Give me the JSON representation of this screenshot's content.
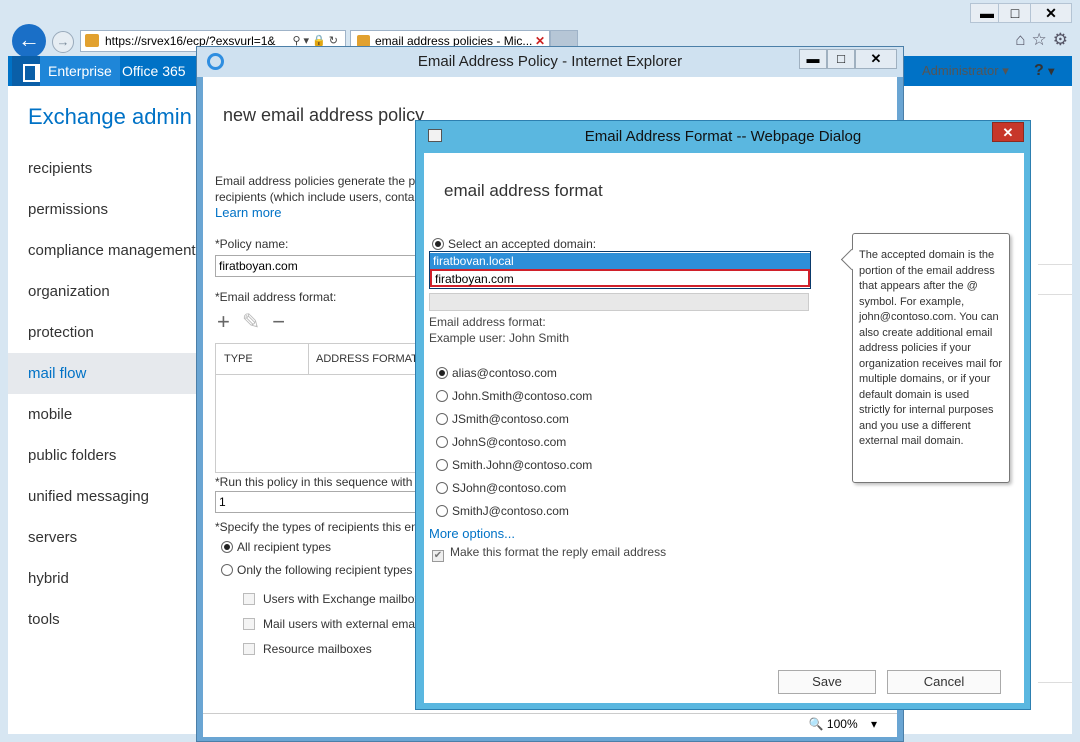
{
  "browser": {
    "url": "https://srvex16/ecp/?exsvurl=1&",
    "tab_title": "email address policies - Mic...",
    "window_controls": {
      "minimize": "▬",
      "maximize": "□",
      "close": "✕"
    }
  },
  "eac": {
    "header_links": [
      "Enterprise",
      "Office 365"
    ],
    "title": "Exchange admin c",
    "user": "Administrator",
    "help": "?",
    "nav": [
      {
        "label": "recipients",
        "active": false
      },
      {
        "label": "permissions",
        "active": false
      },
      {
        "label": "compliance management",
        "active": false
      },
      {
        "label": "organization",
        "active": false
      },
      {
        "label": "protection",
        "active": false
      },
      {
        "label": "mail flow",
        "active": true
      },
      {
        "label": "mobile",
        "active": false
      },
      {
        "label": "public folders",
        "active": false
      },
      {
        "label": "unified messaging",
        "active": false
      },
      {
        "label": "servers",
        "active": false
      },
      {
        "label": "hybrid",
        "active": false
      },
      {
        "label": "tools",
        "active": false
      }
    ]
  },
  "policy_window": {
    "title": "Email Address Policy - Internet Explorer",
    "heading": "new email address policy",
    "description_line1": "Email address policies generate the pr",
    "description_line2": "recipients (which include users, conta",
    "learn_more": "Learn more",
    "policy_name_label": "*Policy name:",
    "policy_name_value": "firatboyan.com",
    "email_format_label": "*Email address format:",
    "table_headers": [
      "TYPE",
      "ADDRESS FORMAT"
    ],
    "sequence_label": "*Run this policy in this sequence with",
    "sequence_value": "1",
    "recipient_types_label": "*Specify the types of recipients this en",
    "recipient_options": [
      "All recipient types",
      "Only the following recipient types"
    ],
    "recipient_checkboxes": [
      "Users with Exchange mailbox",
      "Mail users with external emai",
      "Resource mailboxes"
    ],
    "zoom": "100%"
  },
  "dialog": {
    "title": "Email Address Format -- Webpage Dialog",
    "close": "✕",
    "heading": "email address format",
    "select_domain_label": "Select an accepted domain:",
    "domains": [
      "firatbovan.local",
      "firatboyan.com"
    ],
    "format_label": "Email address format:",
    "example_user": "Example user: John Smith",
    "formats": [
      {
        "label": "alias@contoso.com",
        "checked": true
      },
      {
        "label": "John.Smith@contoso.com",
        "checked": false
      },
      {
        "label": "JSmith@contoso.com",
        "checked": false
      },
      {
        "label": "JohnS@contoso.com",
        "checked": false
      },
      {
        "label": "Smith.John@contoso.com",
        "checked": false
      },
      {
        "label": "SJohn@contoso.com",
        "checked": false
      },
      {
        "label": "SmithJ@contoso.com",
        "checked": false
      }
    ],
    "more_options": "More options...",
    "reply_checkbox": "Make this format the reply email address",
    "tooltip": "The accepted domain is the portion of the email address that appears after the @ symbol. For example, john@contoso.com. You can also create additional email address policies if your organization receives mail for multiple domains, or if your default domain is used strictly for internal purposes and you use a different external mail domain.",
    "save": "Save",
    "cancel": "Cancel"
  }
}
